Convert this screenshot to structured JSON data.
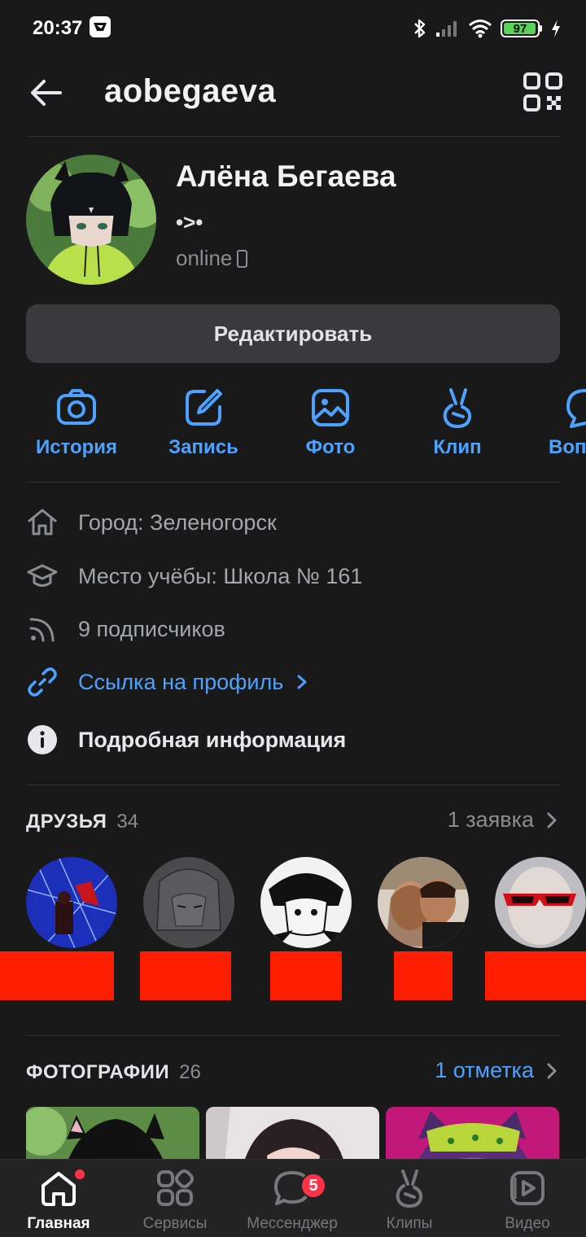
{
  "status_bar": {
    "time": "20:37",
    "battery": "97",
    "battery_level": 0.97
  },
  "header": {
    "username": "aobegaeva"
  },
  "profile": {
    "name": "Алёна Бегаева",
    "status": "•>•",
    "online": "online"
  },
  "edit_button": "Редактировать",
  "actions": [
    {
      "label": "История",
      "icon": "camera-icon"
    },
    {
      "label": "Запись",
      "icon": "edit-icon"
    },
    {
      "label": "Фото",
      "icon": "image-icon"
    },
    {
      "label": "Клип",
      "icon": "clip-icon"
    },
    {
      "label": "Вопр",
      "icon": "question-icon"
    }
  ],
  "info": {
    "city": "Город: Зеленогорск",
    "school": "Место учёбы: Школа № 161",
    "followers": "9 подписчиков",
    "profile_link": "Ссылка на профиль",
    "details": "Подробная информация"
  },
  "friends": {
    "title": "ДРУЗЬЯ",
    "count": "34",
    "requests": "1 заявка"
  },
  "photos": {
    "title": "ФОТОГРАФИИ",
    "count": "26",
    "tags": "1 отметка"
  },
  "tabbar": [
    {
      "label": "Главная",
      "icon": "home-icon",
      "active": true
    },
    {
      "label": "Сервисы",
      "icon": "services-icon",
      "active": false
    },
    {
      "label": "Мессенджер",
      "icon": "messenger-icon",
      "active": false,
      "badge": "5"
    },
    {
      "label": "Клипы",
      "icon": "clips-icon",
      "active": false
    },
    {
      "label": "Видео",
      "icon": "video-icon",
      "active": false
    }
  ],
  "colors": {
    "background": "#19191a",
    "accent": "#4da2ff",
    "badge": "#ff3347",
    "redaction": "#ff1e00"
  }
}
